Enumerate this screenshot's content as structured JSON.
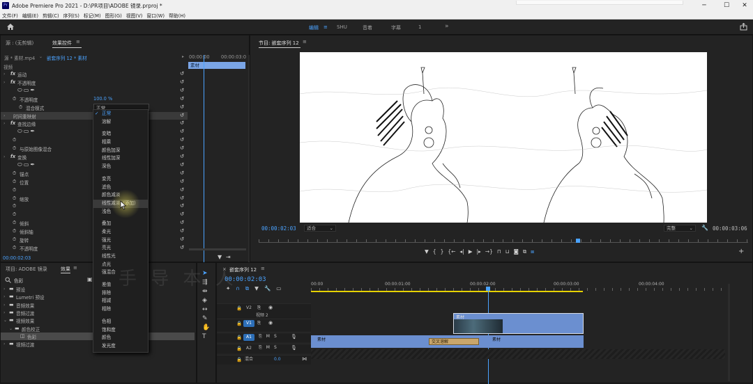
{
  "window": {
    "app_icon": "Pr",
    "title": "Adobe Premiere Pro 2021 - D:\\PR项目\\ADOBE 镜录.prproj *",
    "controls": [
      "─",
      "☐",
      "✕"
    ]
  },
  "menu": [
    "文件(F)",
    "编辑(E)",
    "剪辑(C)",
    "序列(S)",
    "标记(M)",
    "图形(G)",
    "视图(V)",
    "窗口(W)",
    "帮助(H)"
  ],
  "workspaces": {
    "items": [
      "编辑",
      "SHU",
      "音着",
      "字幕",
      "1"
    ],
    "active": "编辑",
    "menu_glyph": "≡",
    "more": "»"
  },
  "effect_controls": {
    "tabs": [
      "源 : (无剪辑)",
      "效果控件"
    ],
    "active_tab": "效果控件",
    "source_label": "源 * 素材.mp4",
    "sequence_label": "嵌套序列 12 * 素材",
    "timecode_start": "00:00:00",
    "timecode_end": "00:00:03:0",
    "clip_label": "素材",
    "section": "视频",
    "rows": [
      {
        "indent": 1,
        "fx": true,
        "label": "运动"
      },
      {
        "indent": 1,
        "fx": true,
        "label": "不透明度"
      },
      {
        "indent": 2,
        "shapes": true
      },
      {
        "indent": 2,
        "label": "不透明度",
        "value": "100.0 %"
      },
      {
        "indent": 3,
        "label": "混合模式",
        "value": "正常"
      },
      {
        "indent": 1,
        "label": "时间重映射",
        "highlight": true
      },
      {
        "indent": 1,
        "fx": true,
        "label": "查找边缘"
      },
      {
        "indent": 2,
        "shapes": true
      },
      {
        "indent": 2,
        "label": ""
      },
      {
        "indent": 2,
        "label": "与原始图像混合"
      },
      {
        "indent": 1,
        "fx": true,
        "label": "变换"
      },
      {
        "indent": 2,
        "shapes": true
      },
      {
        "indent": 2,
        "label": "锚点"
      },
      {
        "indent": 2,
        "label": "位置"
      },
      {
        "indent": 2,
        "label": ""
      },
      {
        "indent": 2,
        "label": "缩放"
      },
      {
        "indent": 2,
        "label": ""
      },
      {
        "indent": 2,
        "label": ""
      },
      {
        "indent": 2,
        "label": "倾斜"
      },
      {
        "indent": 2,
        "label": "倾斜轴"
      },
      {
        "indent": 2,
        "label": "旋转"
      },
      {
        "indent": 2,
        "label": "不透明度"
      }
    ],
    "bottom_timecode": "00:00:02:03"
  },
  "blend_dropdown": {
    "options": [
      "正常",
      "溶解",
      "-",
      "变暗",
      "相乘",
      "颜色加深",
      "线性加深",
      "深色",
      "-",
      "变亮",
      "滤色",
      "颜色减淡",
      "线性减淡（添加）",
      "浅色",
      "-",
      "叠加",
      "柔光",
      "强光",
      "亮光",
      "线性光",
      "点光",
      "强混合",
      "-",
      "差值",
      "排除",
      "相减",
      "相除",
      "-",
      "色相",
      "饱和度",
      "颜色",
      "发光度"
    ],
    "selected": "正常",
    "hovered": "线性减淡（添加）"
  },
  "project_panel": {
    "tabs": [
      "项目: ADOBE 镜录",
      "效果"
    ],
    "active_tab": "效果",
    "search_value": "色彩",
    "tree": [
      {
        "indent": 0,
        "label": "预设"
      },
      {
        "indent": 0,
        "label": "Lumetri 预设"
      },
      {
        "indent": 0,
        "label": "音频效果"
      },
      {
        "indent": 0,
        "label": "音频过渡"
      },
      {
        "indent": 0,
        "label": "视频效果",
        "open": true
      },
      {
        "indent": 1,
        "label": "颜色校正",
        "open": true
      },
      {
        "indent": 2,
        "label": "色彩",
        "selected": true,
        "effect": true
      },
      {
        "indent": 0,
        "label": "视频过渡"
      }
    ]
  },
  "program_monitor": {
    "title": "节目: 嵌套序列 12",
    "timecode": "00:00:02:03",
    "fit": "适合",
    "quality": "完整",
    "duration": "00:00:03:06",
    "watermark": "手 导 本 人"
  },
  "timeline": {
    "tab": "嵌套序列 12",
    "timecode": "00:00:02:03",
    "ruler": [
      "00:00",
      "00:00:01:00",
      "00:00:02:00",
      "00:00:03:00",
      "00:00:04:00"
    ],
    "tracks": [
      {
        "id": "V2",
        "name": "视频 2",
        "type": "video"
      },
      {
        "id": "V1",
        "name": "",
        "type": "video",
        "targeted": true
      },
      {
        "id": "A1",
        "name": "",
        "type": "audio",
        "targeted": true
      },
      {
        "id": "A2",
        "name": "",
        "type": "audio"
      },
      {
        "id": "混合",
        "name": "",
        "type": "mix",
        "value": "0.0"
      }
    ],
    "clips": [
      {
        "track": "V2",
        "label": "素材",
        "start": 1.74,
        "end": 3.65,
        "thumb": true
      },
      {
        "track": "V1",
        "label": "素材",
        "start": 0.0,
        "end": 1.74
      },
      {
        "track": "V1",
        "label": "素材",
        "start": 2.0,
        "end": 3.65
      },
      {
        "track": "V1",
        "label": "交叉溶解",
        "start": 1.4,
        "end": 2.2,
        "transition": true
      }
    ],
    "playhead_seconds": 2.13,
    "duration_seconds": 3.25
  }
}
